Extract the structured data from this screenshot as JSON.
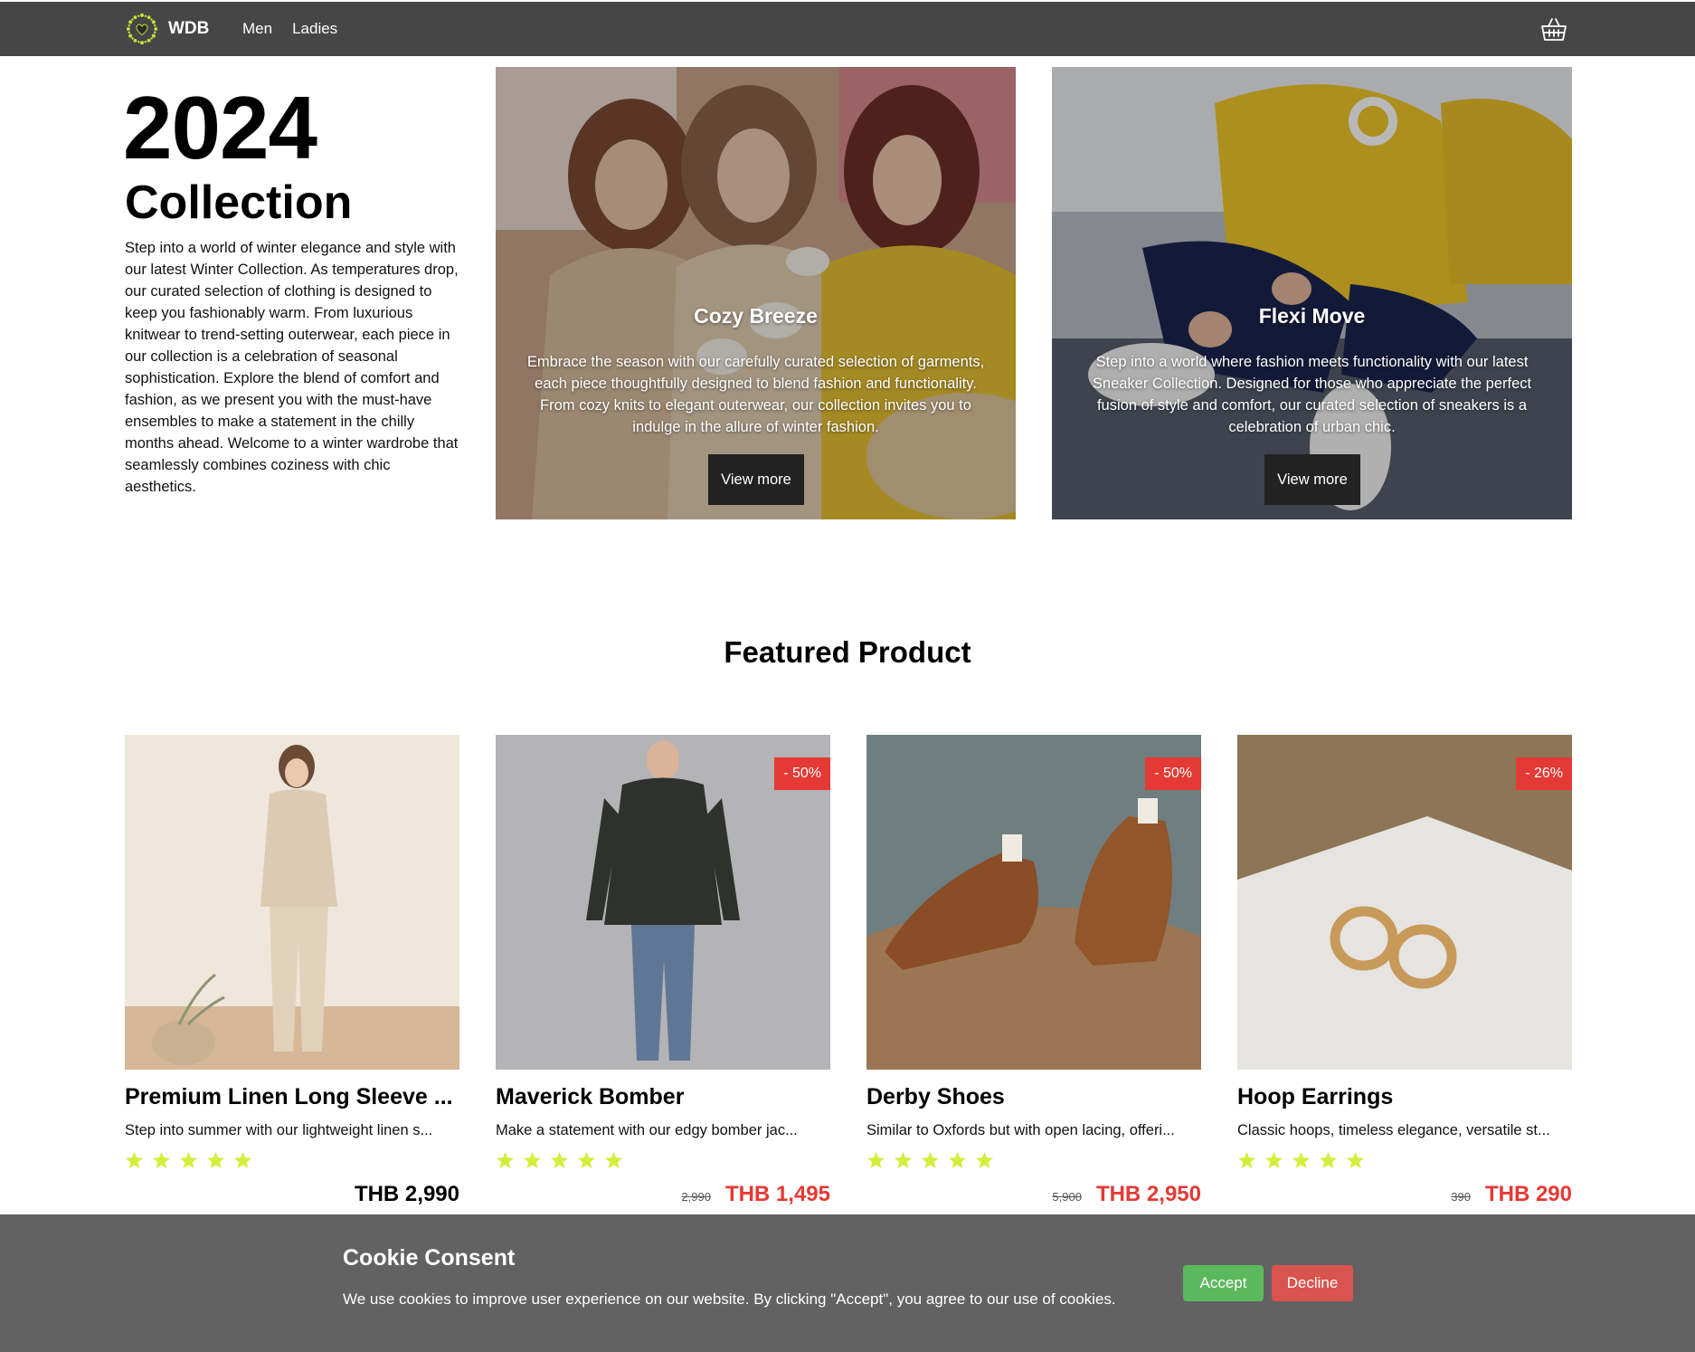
{
  "nav": {
    "brand": "WDB",
    "links": [
      "Men",
      "Ladies"
    ],
    "logo_icon": "sun-wreath-logo",
    "cart_icon": "shopping-basket-icon"
  },
  "hero": {
    "year": "2024",
    "subtitle": "Collection",
    "text": "Step into a world of winter elegance and style with our latest Winter Collection. As temperatures drop, our curated selection of clothing is designed to keep you fashionably warm. From luxurious knitwear to trend-setting outerwear, each piece in our collection is a celebration of seasonal sophistication. Explore the blend of comfort and fashion, as we present you with the must-have ensembles to make a statement in the chilly months ahead. Welcome to a winter wardrobe that seamlessly combines coziness with chic aesthetics."
  },
  "promos": [
    {
      "title": "Cozy Breeze",
      "text": "Embrace the season with our carefully curated selection of garments, each piece thoughtfully designed to blend fashion and functionality. From cozy knits to elegant outerwear, our collection invites you to indulge in the allure of winter fashion.",
      "button": "View more"
    },
    {
      "title": "Flexi Move",
      "text": "Step into a world where fashion meets functionality with our latest Sneaker Collection. Designed for those who appreciate the perfect fusion of style and comfort, our curated selection of sneakers is a celebration of urban chic.",
      "button": "View more"
    }
  ],
  "featured": {
    "title": "Featured Product",
    "products": [
      {
        "name": "Premium Linen Long Sleeve ...",
        "desc": "Step into summer with our lightweight linen s...",
        "badge": "",
        "old_price": "",
        "price": "THB 2,990",
        "rating": 5
      },
      {
        "name": "Maverick Bomber",
        "desc": "Make a statement with our edgy bomber jac...",
        "badge": "- 50%",
        "old_price": "2,990",
        "price": "THB 1,495",
        "rating": 5
      },
      {
        "name": "Derby Shoes",
        "desc": "Similar to Oxfords but with open lacing, offeri...",
        "badge": "- 50%",
        "old_price": "5,900",
        "price": "THB 2,950",
        "rating": 5
      },
      {
        "name": "Hoop Earrings",
        "desc": "Classic hoops, timeless elegance, versatile st...",
        "badge": "- 26%",
        "old_price": "390",
        "price": "THB 290",
        "rating": 5
      }
    ]
  },
  "cookie": {
    "title": "Cookie Consent",
    "text": "We use cookies to improve user experience on our website. By clicking \"Accept\", you agree to our use of cookies.",
    "accept": "Accept",
    "decline": "Decline"
  },
  "colors": {
    "nav_bg": "#464646",
    "sale_red": "#e53935",
    "star": "#d4ee3c",
    "accept_green": "#5cb85c",
    "decline_red": "#d9534f",
    "cookie_bg": "#626262"
  }
}
